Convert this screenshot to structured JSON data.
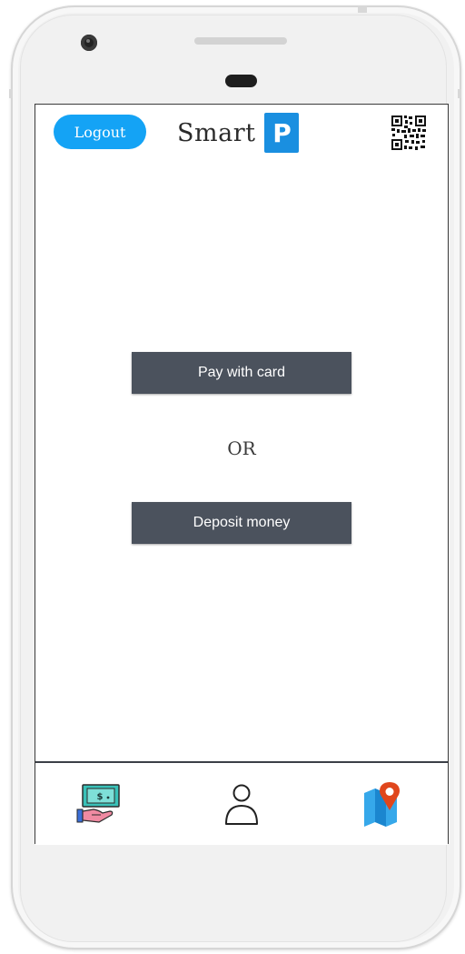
{
  "header": {
    "logout_label": "Logout",
    "logo_text": "Smart",
    "logo_badge": "P",
    "qr_icon": "qr-code-icon"
  },
  "main": {
    "pay_label": "Pay with card",
    "or_label": "OR",
    "deposit_label": "Deposit money"
  },
  "bottom_nav": [
    {
      "icon": "money-hand-icon"
    },
    {
      "icon": "user-icon"
    },
    {
      "icon": "map-pin-icon"
    }
  ],
  "colors": {
    "accent": "#14a3f5",
    "logo_badge": "#1a8fe0",
    "button": "#4b525d",
    "map_pin": "#e0461c"
  }
}
